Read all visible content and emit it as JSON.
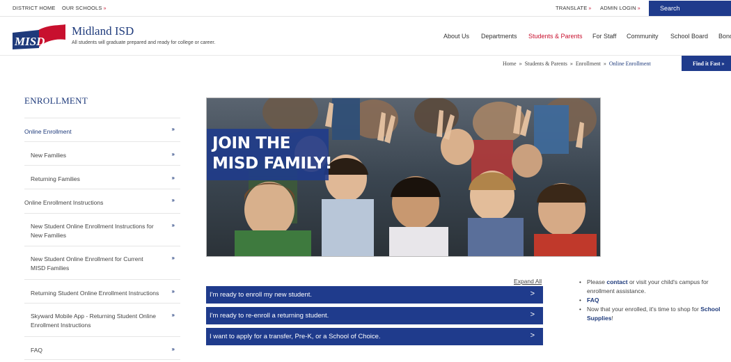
{
  "utility": {
    "district_home": "DISTRICT HOME",
    "our_schools": "OUR SCHOOLS",
    "translate": "TRANSLATE",
    "admin_login": "ADMIN LOGIN",
    "arrow": "»",
    "search": "Search"
  },
  "header": {
    "logo_text": "MISD",
    "title": "Midland ISD",
    "tagline": "All students will graduate prepared and ready for college or career.",
    "nav": [
      "About Us",
      "Departments",
      "Students & Parents",
      "For Staff",
      "Community",
      "School Board",
      "Bonds"
    ]
  },
  "breadcrumb": {
    "items": [
      "Home",
      "Students & Parents",
      "Enrollment",
      "Online Enrollment"
    ],
    "sep": "»",
    "find_it_fast": "Find it Fast »"
  },
  "sidebar": {
    "title": "ENROLLMENT",
    "items": [
      {
        "label": "Online Enrollment",
        "chev": "»"
      },
      {
        "label": "New Families",
        "chev": "»"
      },
      {
        "label": "Returning Families",
        "chev": "»"
      },
      {
        "label": "Online Enrollment Instructions",
        "chev": "»"
      },
      {
        "label": "New Student Online Enrollment Instructions for New Families",
        "chev": "»"
      },
      {
        "label": "New Student Online Enrollment for Current MISD Families",
        "chev": "»"
      },
      {
        "label": "Returning Student Online Enrollment Instructions",
        "chev": "»"
      },
      {
        "label": "Skyward Mobile App - Returning Student Online Enrollment Instructions",
        "chev": "»"
      },
      {
        "label": "FAQ",
        "chev": "»"
      }
    ]
  },
  "hero": {
    "line1": "JOIN THE",
    "line2": "MISD FAMILY!"
  },
  "accordion": {
    "expand_all": "Expand All",
    "items": [
      {
        "label": "I'm ready to enroll my new student.",
        "chev": ">"
      },
      {
        "label": "I'm ready to re-enroll a returning student.",
        "chev": ">"
      },
      {
        "label": "I want to apply for a transfer, Pre-K, or a School of Choice.",
        "chev": ">"
      }
    ]
  },
  "notes": {
    "bullet": "•",
    "n1_pre": "Please ",
    "n1_link": "contact",
    "n1_post": " or visit your child's campus for enrollment assistance.",
    "n2_link": "FAQ",
    "n3_pre": "Now that your enrolled, it's time to shop for ",
    "n3_link": "School Supplies",
    "n3_post": "!"
  },
  "colors": {
    "brand_blue": "#1f3b8c",
    "accent_red": "#c8102e",
    "link_blue": "#1e3a7b"
  }
}
